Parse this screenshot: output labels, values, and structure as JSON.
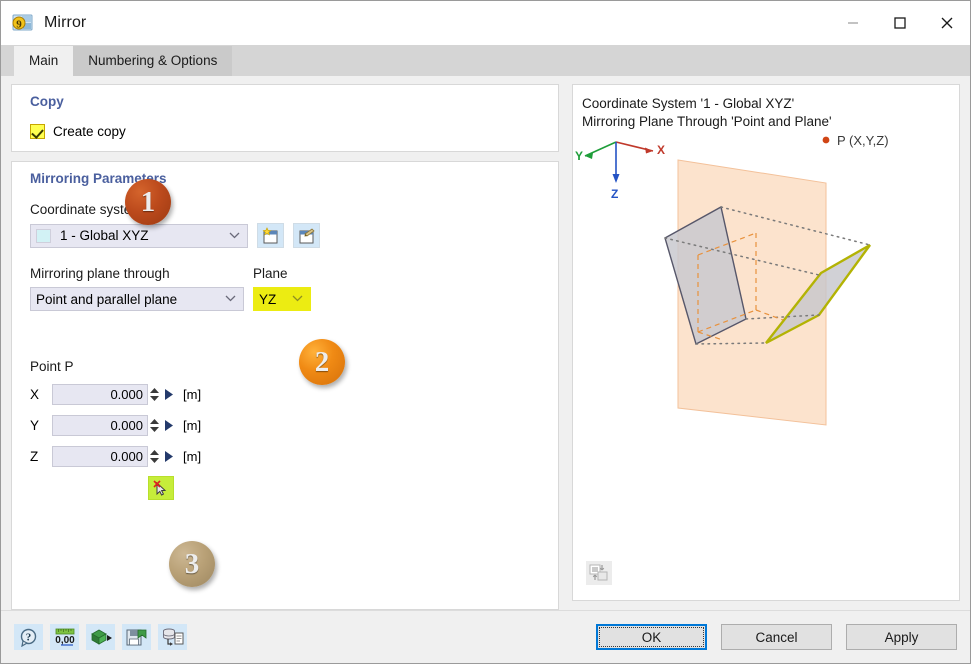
{
  "window": {
    "title": "Mirror",
    "icon": "mirror-app-icon",
    "minimize_label": "—",
    "maximize_label": "□",
    "close_label": "✕"
  },
  "tabs": [
    {
      "label": "Main",
      "active": true
    },
    {
      "label": "Numbering & Options",
      "active": false
    }
  ],
  "copy_section": {
    "title": "Copy",
    "checkbox_label": "Create copy",
    "checked": true
  },
  "mirroring_section": {
    "title": "Mirroring Parameters",
    "coordinate_system_label": "Coordinate system",
    "coordinate_system_value": "1 - Global XYZ",
    "coordinate_system_swatch_color": "#d2f2f5",
    "new_cs_button": "new-coordinate-system",
    "edit_cs_button": "edit-coordinate-system",
    "plane_through_label": "Mirroring plane through",
    "plane_through_value": "Point and parallel plane",
    "plane_label": "Plane",
    "plane_value": "YZ",
    "plane_highlight_color": "#ecec12",
    "point_label": "Point P",
    "coordinates": [
      {
        "axis": "X",
        "value": "0.000",
        "unit": "[m]"
      },
      {
        "axis": "Y",
        "value": "0.000",
        "unit": "[m]"
      },
      {
        "axis": "Z",
        "value": "0.000",
        "unit": "[m]"
      }
    ],
    "pick_button_label": "pick-point-in-graphic",
    "pick_button_color": "#c6ed3a"
  },
  "preview": {
    "line1": "Coordinate System '1 - Global XYZ'",
    "line2": "Mirroring Plane Through 'Point and Plane'",
    "axis_x_label": "X",
    "axis_y_label": "Y",
    "axis_z_label": "Z",
    "point_label": "P (X,Y,Z)",
    "mirror_plane_color": "#fbe0c8",
    "original_object_color": "#c6c6cc",
    "mirrored_object_outline": "#b3b304",
    "swap_icon": "toggle-preview-image"
  },
  "badges": [
    {
      "number": "1",
      "step": "create-copy"
    },
    {
      "number": "2",
      "step": "select-plane"
    },
    {
      "number": "3",
      "step": "pick-point"
    }
  ],
  "bottom_toolbar": [
    {
      "name": "help-icon"
    },
    {
      "name": "units-icon"
    },
    {
      "name": "settings-icon"
    },
    {
      "name": "save-defaults-icon"
    },
    {
      "name": "database-import-icon"
    }
  ],
  "dialog_buttons": {
    "ok": "OK",
    "cancel": "Cancel",
    "apply": "Apply"
  }
}
